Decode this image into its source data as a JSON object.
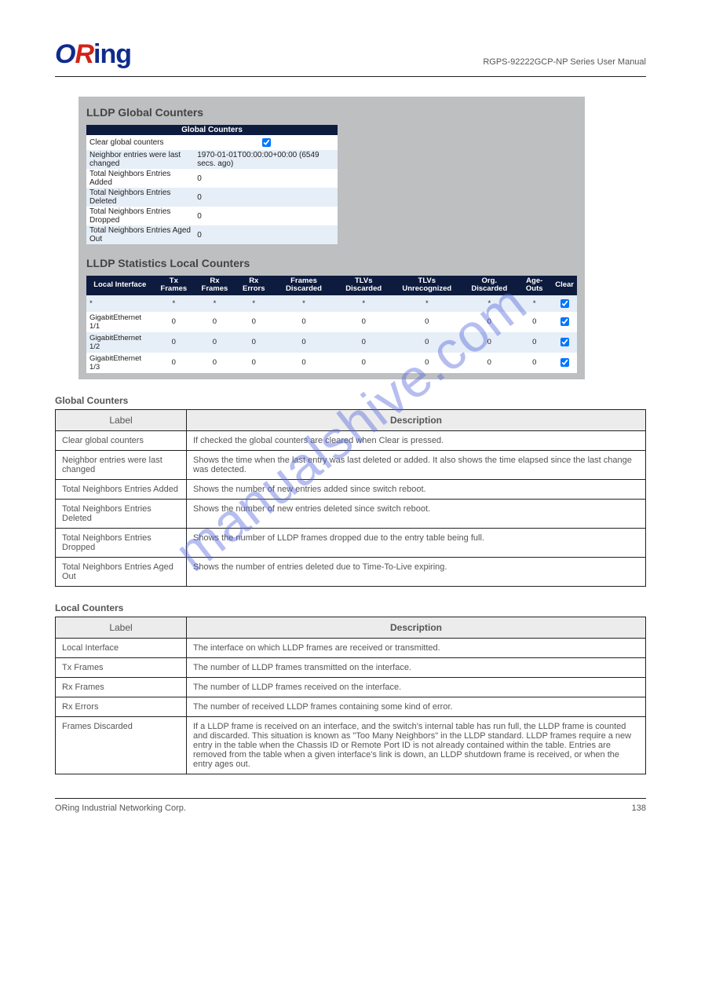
{
  "header": {
    "model": "RGPS-92222GCP-NP Series User Manual"
  },
  "watermark": "manualshive.com",
  "ui": {
    "title1": "LLDP Global Counters",
    "title2": "LLDP Statistics Local Counters",
    "gc": {
      "heading": "Global Counters",
      "rows": {
        "clear": "Clear global counters",
        "last_label": "Neighbor entries were last changed",
        "last_value": "1970-01-01T00:00:00+00:00 (6549 secs. ago)",
        "added_label": "Total Neighbors Entries Added",
        "added_value": "0",
        "deleted_label": "Total Neighbors Entries Deleted",
        "deleted_value": "0",
        "dropped_label": "Total Neighbors Entries Dropped",
        "dropped_value": "0",
        "aged_label": "Total Neighbors Entries Aged Out",
        "aged_value": "0"
      }
    },
    "lc": {
      "head": {
        "c0": "Local Interface",
        "c1": "Tx Frames",
        "c2": "Rx Frames",
        "c3": "Rx Errors",
        "c4": "Frames Discarded",
        "c5": "TLVs Discarded",
        "c6": "TLVs Unrecognized",
        "c7": "Org. Discarded",
        "c8": "Age-Outs",
        "c9": "Clear"
      },
      "rows": {
        "star": {
          "c0": "*",
          "c1": "*",
          "c2": "*",
          "c3": "*",
          "c4": "*",
          "c5": "*",
          "c6": "*",
          "c7": "*",
          "c8": "*"
        },
        "r1": {
          "name": "GigabitEthernet 1/1",
          "v": "0"
        },
        "r2": {
          "name": "GigabitEthernet 1/2",
          "v": "0"
        },
        "r3": {
          "name": "GigabitEthernet 1/3",
          "v": "0"
        }
      }
    }
  },
  "global_table": {
    "heading": "Global Counters",
    "col_label": "Label",
    "col_desc": "Description",
    "rows": {
      "r0": {
        "label": "Clear global counters",
        "desc": "If checked the global counters are cleared when Clear is pressed."
      },
      "r1": {
        "label": "Neighbor entries were last changed",
        "desc": "Shows the time when the last entry was last deleted or added. It also shows the time elapsed since the last change was detected."
      },
      "r2": {
        "label": "Total Neighbors Entries Added",
        "desc": "Shows the number of new entries added since switch reboot."
      },
      "r3": {
        "label": "Total Neighbors Entries Deleted",
        "desc": "Shows the number of new entries deleted since switch reboot."
      },
      "r4": {
        "label": "Total Neighbors Entries Dropped",
        "desc": "Shows the number of LLDP frames dropped due to the entry table being full."
      },
      "r5": {
        "label": "Total Neighbors Entries Aged Out",
        "desc": "Shows the number of entries deleted due to Time-To-Live expiring."
      }
    }
  },
  "local_table": {
    "heading": "Local Counters",
    "col_label": "Label",
    "col_desc": "Description",
    "rows": {
      "r0": {
        "label": "Local Interface",
        "desc": "The interface on which LLDP frames are received or transmitted."
      },
      "r1": {
        "label": "Tx Frames",
        "desc": "The number of LLDP frames transmitted on the interface."
      },
      "r2": {
        "label": "Rx Frames",
        "desc": "The number of LLDP frames received on the interface."
      },
      "r3": {
        "label": "Rx Errors",
        "desc": "The number of received LLDP frames containing some kind of error."
      },
      "r4": {
        "label": "Frames Discarded",
        "desc": "If a LLDP frame is received on an interface, and the switch's internal table has run full, the LLDP frame is counted and discarded. This situation is known as \"Too Many Neighbors\" in the LLDP standard. LLDP frames require a new entry in the table when the Chassis ID or Remote Port ID is not already contained within the table. Entries are removed from the table when a given interface's link is down, an LLDP shutdown frame is received, or when the entry ages out."
      }
    }
  },
  "footer": {
    "left": "ORing Industrial Networking Corp.",
    "right": "138"
  }
}
